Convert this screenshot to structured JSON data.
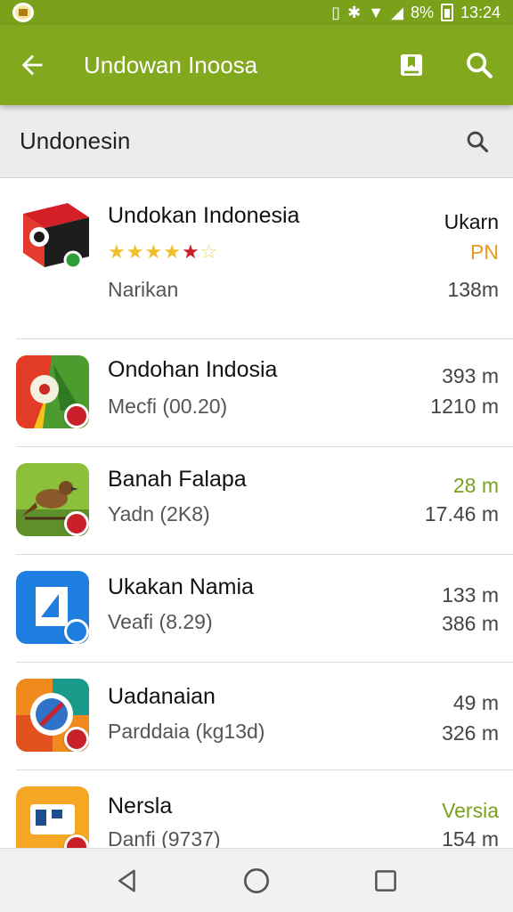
{
  "status_bar": {
    "battery_text": "8%",
    "time": "13:24"
  },
  "app_bar": {
    "title": "Undowan Inoosa",
    "back_icon": "arrow-left-icon",
    "bookmark_icon": "bookmark-icon",
    "search_icon": "search-icon",
    "background": "#82a91d"
  },
  "search": {
    "query": "Undonesin"
  },
  "apps": [
    {
      "title": "Undokan Indonesia",
      "rating": 4.5,
      "subtitle": "Narikan",
      "right_top": "Ukarn",
      "right_mid": "PN",
      "right_bottom": "138m"
    },
    {
      "title": "Ondohan Indosia",
      "subtitle": "Mecfi (00.20)",
      "right_top": "393 m",
      "right_bottom": "1210 m"
    },
    {
      "title": "Banah Falapa",
      "subtitle": "Yadn (2K8)",
      "right_top": "28 m",
      "right_bottom": "17.46 m"
    },
    {
      "title": "Ukakan Namia",
      "subtitle": "Veafi (8.29)",
      "right_top": "133 m",
      "right_bottom": "386 m"
    },
    {
      "title": "Uadanaian",
      "subtitle": "Parddaia (kg13d)",
      "right_top": "49 m",
      "right_bottom": "326 m"
    },
    {
      "title": "Nersla",
      "subtitle": "Danfi (9737)",
      "right_top": "Versia",
      "right_bottom": "154 m"
    }
  ],
  "nav_bar": {
    "back_icon": "triangle-back-icon",
    "home_icon": "circle-home-icon",
    "recents_icon": "square-recents-icon"
  },
  "colors": {
    "accent_green": "#7aa11a",
    "accent_orange": "#e79a1f",
    "star_gold": "#f2bf2c",
    "star_red": "#c8212b"
  }
}
